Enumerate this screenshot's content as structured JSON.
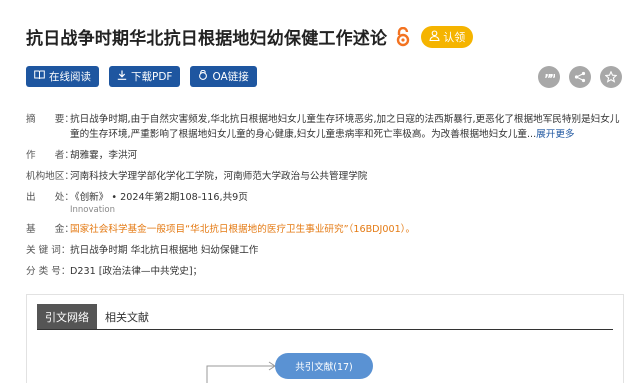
{
  "article": {
    "title": "抗日战争时期华北抗日根据地妇幼保健工作述论",
    "claim_label": "认领"
  },
  "actions": {
    "read_online": "在线阅读",
    "download_pdf": "下载PDF",
    "oa_link": "OA链接"
  },
  "meta": {
    "abstract_label": "摘　　要：",
    "abstract_text": "抗日战争时期,由于自然灾害频发,华北抗日根据地妇女儿童生存环境恶劣,加之日寇的法西斯暴行,更恶化了根据地军民特别是妇女儿童的生存环境,严重影响了根据地妇女儿童的身心健康,妇女儿童患病率和死亡率极高。为改善根据地妇女儿童...",
    "more_label": "展开更多",
    "authors_label": "作　　者：",
    "authors": "胡雅霎，李洪河",
    "institution_label": "机构地区：",
    "institution": "河南科技大学理学部化学化工学院，河南师范大学政治与公共管理学院",
    "source_label": "出　　处：",
    "source": "《创新》 • 2024年第2期108-116,共9页",
    "source_sub": "Innovation",
    "fund_label": "基　　金：",
    "fund": "国家社会科学基金一般项目“华北抗日根据地的医疗卫生事业研究”（16BDJ001）。",
    "keywords_label": "关 键 词：",
    "keywords": "抗日战争时期  华北抗日根据地  妇幼保健工作",
    "class_label": "分 类 号：",
    "class": "D231 [政治法律—中共党史]；"
  },
  "panel": {
    "tabs": [
      "引文网络",
      "相关文献"
    ],
    "node_label": "共引文献(17)"
  },
  "colors": {
    "primary_blue": "#1e56a0",
    "claim_yellow": "#f5b400",
    "fund_orange": "#e47a13",
    "node_blue": "#5a92d3",
    "oa_orange": "#f37321"
  },
  "icons": [
    "open-access-icon",
    "user-icon",
    "book-icon",
    "download-icon",
    "oa-link-icon",
    "quote-icon",
    "share-icon",
    "star-icon"
  ]
}
